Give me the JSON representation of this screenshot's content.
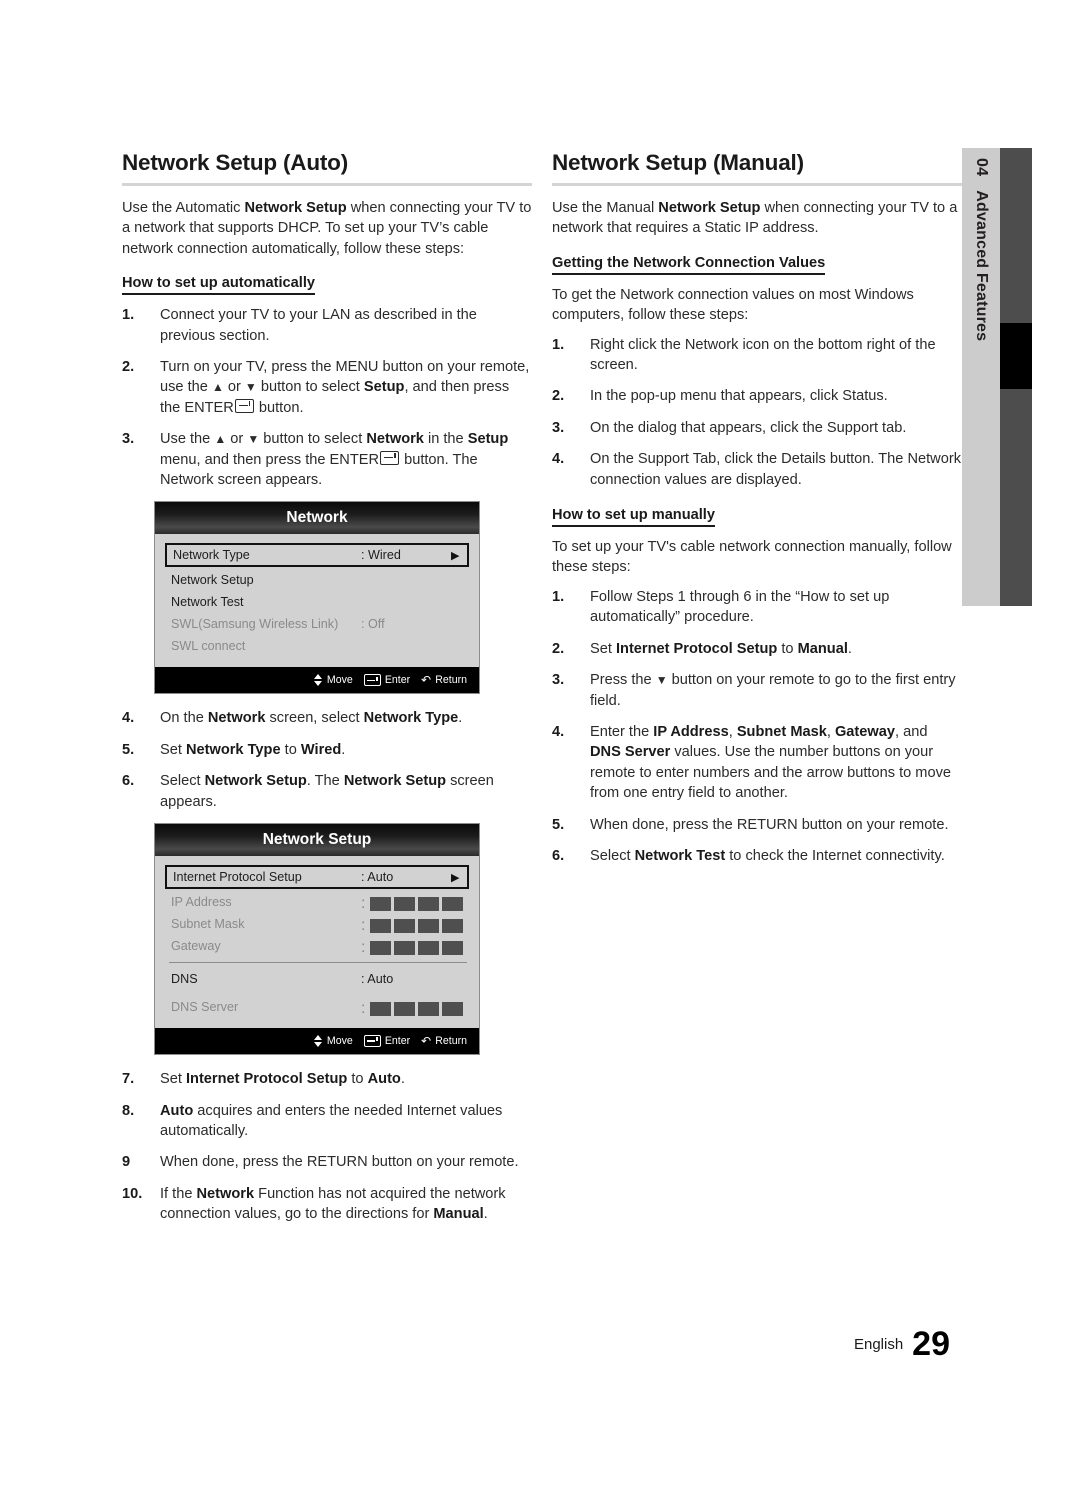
{
  "page": {
    "language": "English",
    "number": "29"
  },
  "side_tab": {
    "chapter_number": "04",
    "chapter_title": "Advanced Features",
    "label_bg": "#cccccc",
    "bar_bg": "#4d4d4d",
    "active_bg": "#000000"
  },
  "left_column": {
    "heading": "Network Setup (Auto)",
    "intro_parts": [
      "Use the Automatic ",
      "Network Setup",
      " when connecting your TV to a network that supports DHCP. To set up your TV’s cable network connection automatically, follow these steps:"
    ],
    "subheading": "How to set up automatically",
    "steps_before_menu1": [
      {
        "num": "1.",
        "text": "Connect your TV to your LAN as described in the previous section."
      },
      {
        "num": "2.",
        "text": "Turn on your TV, press the MENU button on your remote, use the ▲ or ▼ button to select Setup, and then press the ENTER button."
      },
      {
        "num": "3.",
        "text": "Use the ▲ or ▼ button to select Network in the Setup menu, and then press the ENTER button. The Network screen appears."
      }
    ],
    "steps_between_menus": [
      {
        "num": "4.",
        "text": "On the Network screen, select Network Type."
      },
      {
        "num": "5.",
        "text": "Set Network Type to Wired."
      },
      {
        "num": "6.",
        "text": "Select Network Setup. The Network Setup screen appears."
      }
    ],
    "steps_after_menu2": [
      {
        "num": "7.",
        "text": "Set Internet Protocol Setup to Auto."
      },
      {
        "num": "8.",
        "text": "Auto acquires and enters the needed Internet values automatically."
      },
      {
        "num": "9",
        "text": "When done, press the RETURN button on your remote."
      },
      {
        "num": "10.",
        "text": "If the Network Function has not acquired the network connection values, go to the directions for Manual."
      }
    ]
  },
  "right_column": {
    "heading": "Network Setup (Manual)",
    "intro": "Use the Manual Network Setup when connecting your TV to a network that requires a Static IP address.",
    "subheading_1": "Getting the Network Connection Values",
    "lead_1": "To get the Network connection values on most Windows computers, follow these steps:",
    "steps_1": [
      {
        "num": "1.",
        "text": "Right click the Network icon on the bottom right of the screen."
      },
      {
        "num": "2.",
        "text": "In the pop-up menu that appears, click Status."
      },
      {
        "num": "3.",
        "text": "On the dialog that appears, click the Support tab."
      },
      {
        "num": "4.",
        "text": "On the Support Tab, click the Details button. The Network connection values are displayed."
      }
    ],
    "subheading_2": "How to set up manually",
    "lead_2": "To set up your TV's cable network connection manually, follow these steps:",
    "steps_2": [
      {
        "num": "1.",
        "text": "Follow Steps 1 through 6 in the “How to set up automatically” procedure."
      },
      {
        "num": "2.",
        "text": "Set Internet Protocol Setup to Manual."
      },
      {
        "num": "3.",
        "text": "Press the ▼ button on your remote to go to the first entry field."
      },
      {
        "num": "4.",
        "text": "Enter the IP Address, Subnet Mask, Gateway, and DNS Server values. Use the number buttons on your remote to enter numbers and the arrow buttons to move from one entry field to another."
      },
      {
        "num": "5.",
        "text": "When done, press the RETURN button on your remote."
      },
      {
        "num": "6.",
        "text": "Select Network Test to check the Internet connectivity."
      }
    ]
  },
  "osd_network": {
    "title": "Network",
    "rows": [
      {
        "label": "Network Type",
        "value": ": Wired",
        "selected": true,
        "dim": false,
        "arrow": "▶"
      },
      {
        "label": "Network Setup",
        "value": "",
        "selected": false,
        "dim": false
      },
      {
        "label": "Network Test",
        "value": "",
        "selected": false,
        "dim": false
      },
      {
        "label": "SWL(Samsung Wireless Link)",
        "value": ": Off",
        "selected": false,
        "dim": true
      },
      {
        "label": "SWL connect",
        "value": "",
        "selected": false,
        "dim": true
      }
    ],
    "footer": {
      "move": "Move",
      "enter": "Enter",
      "return": "Return"
    }
  },
  "osd_network_setup": {
    "title": "Network Setup",
    "rows": [
      {
        "label": "Internet Protocol Setup",
        "value": ": Auto",
        "selected": true,
        "dim": false,
        "arrow": "▶",
        "blocks": 0
      },
      {
        "label": "IP Address",
        "value": ":",
        "selected": false,
        "dim": true,
        "blocks": 4
      },
      {
        "label": "Subnet Mask",
        "value": ":",
        "selected": false,
        "dim": true,
        "blocks": 4
      },
      {
        "label": "Gateway",
        "value": ":",
        "selected": false,
        "dim": true,
        "blocks": 4
      },
      {
        "label": "DNS",
        "value": ": Auto",
        "selected": false,
        "dim": false,
        "blocks": 0,
        "divider_before": true
      },
      {
        "label": "DNS Server",
        "value": ":",
        "selected": false,
        "dim": true,
        "blocks": 4
      }
    ],
    "footer": {
      "move": "Move",
      "enter": "Enter",
      "return": "Return"
    }
  }
}
